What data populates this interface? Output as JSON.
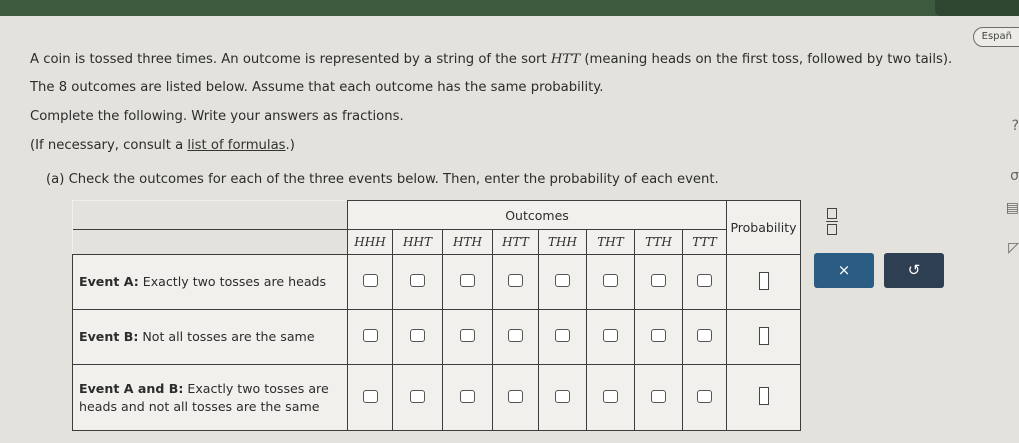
{
  "language_button": "Españ",
  "problem": {
    "line1_pre": "A coin is tossed three times. An outcome is represented by a string of the sort ",
    "line1_var": "HTT",
    "line1_post": " (meaning heads on the first toss, followed by two tails).",
    "line2": "The 8 outcomes are listed below. Assume that each outcome has the same probability.",
    "line3": "Complete the following. Write your answers as fractions.",
    "line4_pre": "(If necessary, consult a ",
    "line4_link": "list of formulas",
    "line4_post": ".)",
    "part_a": "(a) Check the outcomes for each of the three events below. Then, enter the probability of each event."
  },
  "table": {
    "outcomes_header": "Outcomes",
    "probability_header": "Probability",
    "outcomes": [
      "HHH",
      "HHT",
      "HTH",
      "HTT",
      "THH",
      "THT",
      "TTH",
      "TTT"
    ],
    "events": [
      {
        "name": "Event A:",
        "desc": " Exactly two tosses are heads"
      },
      {
        "name": "Event B:",
        "desc": " Not all tosses are the same"
      },
      {
        "name": "Event A and B:",
        "desc": " Exactly two tosses are heads and not all tosses are the same"
      }
    ]
  },
  "tools": {
    "clear_label": "×",
    "undo_label": "↺"
  },
  "colors": {
    "topbar": "#3d5a3f",
    "clear_button": "#2b5c84",
    "undo_button": "#2f3f52"
  }
}
